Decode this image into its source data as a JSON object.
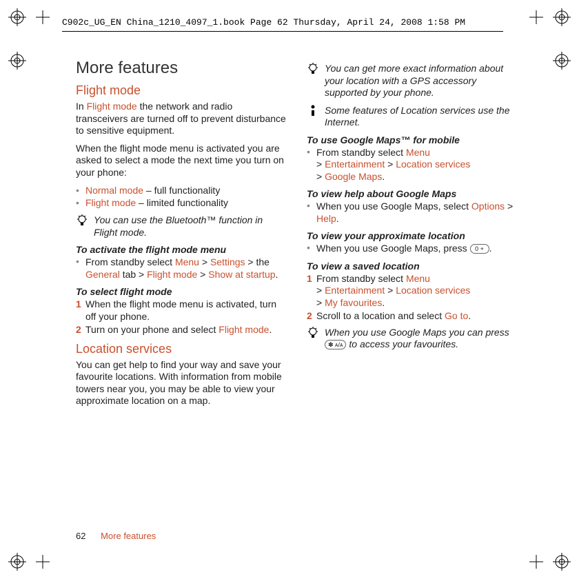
{
  "header": "C902c_UG_EN China_1210_4097_1.book  Page 62  Thursday, April 24, 2008  1:58 PM",
  "footer": {
    "page": "62",
    "section": "More features"
  },
  "col1": {
    "h1": "More features",
    "flight": {
      "title": "Flight mode",
      "p1a": "In ",
      "p1link": "Flight mode",
      "p1b": " the network and radio transceivers are turned off to prevent disturbance to sensitive equipment.",
      "p2": "When the flight mode menu is activated you are asked to select a mode the next time you turn on your phone:",
      "b1link": "Normal mode",
      "b1rest": " – full functionality",
      "b2link": "Flight mode",
      "b2rest": " – limited functionality",
      "tip": "You can use the Bluetooth™ function in Flight mode.",
      "act_head": "To activate the flight mode menu",
      "act_pre": "From standby select ",
      "m_menu": "Menu",
      "gt": " > ",
      "m_settings": "Settings",
      "act_mid": " > the ",
      "m_general": "General",
      "act_tab": " tab > ",
      "m_flight": "Flight mode",
      "m_show": "Show at startup",
      "sel_head": "To select flight mode",
      "sel1": "When the flight mode menu is activated, turn off your phone.",
      "sel2_pre": "Turn on your phone and select ",
      "sel2_link": "Flight mode"
    },
    "loc": {
      "title": "Location services",
      "p1": "You can get help to find your way and save your favourite locations. With information from mobile towers near you, you may be able to view your approximate location on a map."
    }
  },
  "col2": {
    "tip_gps": "You can get more exact information about your location with a GPS accessory supported by your phone.",
    "tip_net": "Some features of Location services use the Internet.",
    "gmaps_head": "To use Google Maps™ for mobile",
    "gmaps_pre": "From standby select ",
    "m_menu": "Menu",
    "gt": " > ",
    "m_ent": "Entertainment",
    "m_loc": "Location services",
    "m_gmaps": "Google Maps",
    "help_head": "To view help about Google Maps",
    "help_pre": "When you use Google Maps, select ",
    "m_options": "Options",
    "m_help": "Help",
    "approx_head": "To view your approximate location",
    "approx_pre": "When you use Google Maps, press ",
    "key0": "0 +",
    "saved_head": "To view a saved location",
    "saved1_pre": "From standby select ",
    "m_fav": "My favourites",
    "saved2_pre": "Scroll to a location and select ",
    "m_goto": "Go to",
    "tip_star_a": "When you use Google Maps you can press ",
    "key_star": "✽ ᴀ/ᴀ",
    "tip_star_b": " to access your favourites."
  }
}
